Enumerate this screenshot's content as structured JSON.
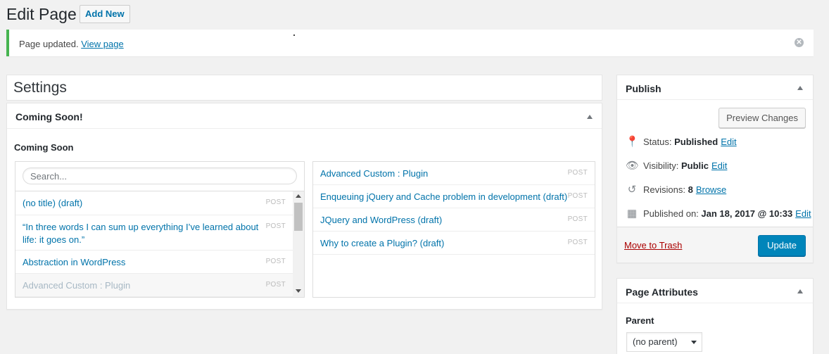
{
  "header": {
    "title": "Edit Page",
    "add_new_label": "Add New"
  },
  "notice": {
    "text": "Page updated.",
    "link": "View page",
    "dismiss": "✕"
  },
  "settings": {
    "title": "Settings"
  },
  "coming_soon": {
    "box_title": "Coming Soon!",
    "section_label": "Coming Soon",
    "search_placeholder": "Search...",
    "available": [
      {
        "title": "(no title) (draft)",
        "type": "POST"
      },
      {
        "title": "“In three words I can sum up everything I’ve learned about life: it goes on.”",
        "type": "POST"
      },
      {
        "title": "Abstraction in WordPress",
        "type": "POST"
      },
      {
        "title": "Advanced Custom : Plugin",
        "type": "POST"
      }
    ],
    "selected": [
      {
        "title": "Advanced Custom : Plugin",
        "type": "POST"
      },
      {
        "title": "Enqueuing jQuery and Cache problem in development (draft)",
        "type": "POST"
      },
      {
        "title": "JQuery and WordPress (draft)",
        "type": "POST"
      },
      {
        "title": "Why to create a Plugin? (draft)",
        "type": "POST"
      }
    ]
  },
  "publish": {
    "title": "Publish",
    "preview_label": "Preview Changes",
    "status_label": "Status:",
    "status_value": "Published",
    "visibility_label": "Visibility:",
    "visibility_value": "Public",
    "revisions_label": "Revisions:",
    "revisions_value": "8",
    "browse_label": "Browse",
    "published_label": "Published on:",
    "published_value": "Jan 18, 2017 @ 10:33",
    "edit_label": "Edit",
    "trash_label": "Move to Trash",
    "update_label": "Update"
  },
  "page_attributes": {
    "title": "Page Attributes",
    "parent_label": "Parent",
    "parent_value": "(no parent)"
  },
  "colors": {
    "notice_border": "#46b450",
    "link": "#0073aa",
    "primary": "#0085ba",
    "trash": "#a00"
  }
}
